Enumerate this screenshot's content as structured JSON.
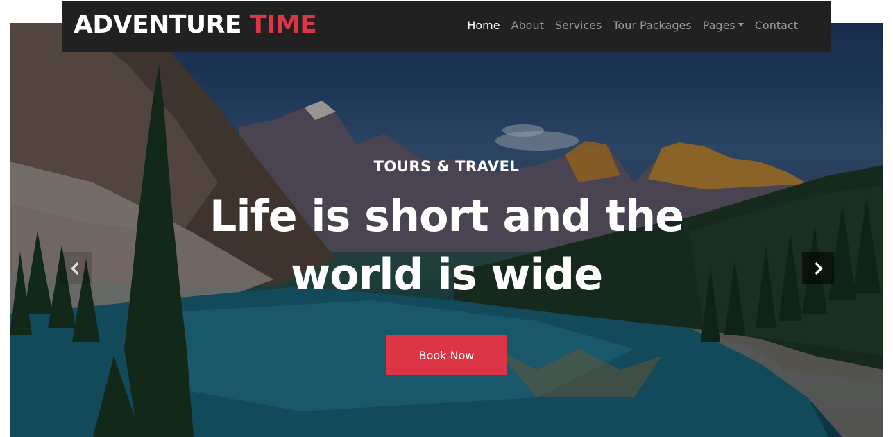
{
  "brand": {
    "main": "ADVENTURE ",
    "accent": "TIME"
  },
  "nav": {
    "items": [
      {
        "label": "Home",
        "active": true
      },
      {
        "label": "About"
      },
      {
        "label": "Services"
      },
      {
        "label": "Tour Packages"
      },
      {
        "label": "Pages",
        "dropdown": true
      },
      {
        "label": "Contact"
      }
    ]
  },
  "hero": {
    "kicker": "TOURS & TRAVEL",
    "headline": "Life is short and the world is wide",
    "button_label": "Book Now",
    "prev_icon": "chevron-left-icon",
    "next_icon": "chevron-right-icon"
  },
  "colors": {
    "accent": "#dc3545",
    "navbar": "#212121",
    "nav_inactive": "#9a9a9a"
  }
}
